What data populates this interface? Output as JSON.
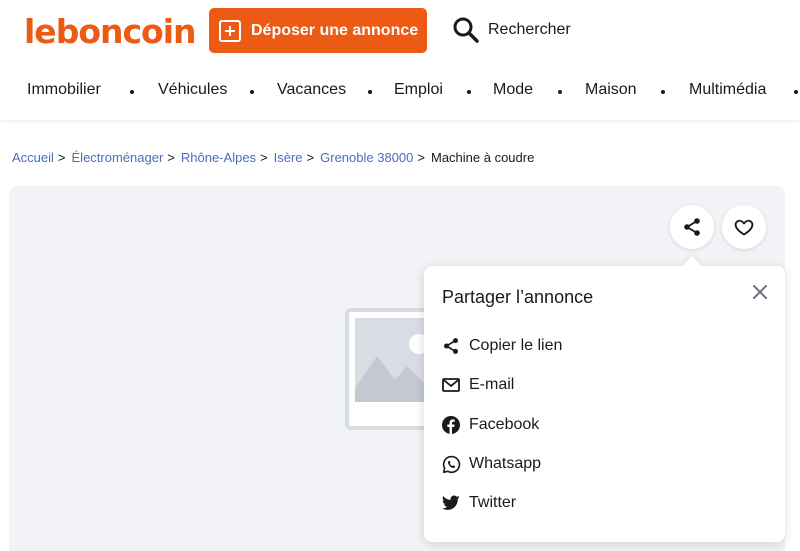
{
  "header": {
    "logo": "leboncoin",
    "post_button": "Déposer une annonce",
    "search_label": "Rechercher",
    "brand_color": "#ec5a13"
  },
  "nav": {
    "items": [
      "Immobilier",
      "Véhicules",
      "Vacances",
      "Emploi",
      "Mode",
      "Maison",
      "Multimédia"
    ]
  },
  "breadcrumb": {
    "links": [
      "Accueil",
      "Électroménager",
      "Rhône-Alpes",
      "Isère",
      "Grenoble 38000"
    ],
    "separator": ">",
    "current": "Machine à coudre"
  },
  "gallery": {
    "share_icon": "share-icon",
    "favorite_icon": "heart-icon",
    "placeholder_icon": "image-placeholder-icon"
  },
  "share_popover": {
    "title": "Partager l’annonce",
    "close_icon": "close-icon",
    "items": [
      {
        "label": "Copier le lien",
        "icon": "share-icon"
      },
      {
        "label": "E-mail",
        "icon": "mail-icon"
      },
      {
        "label": "Facebook",
        "icon": "facebook-icon"
      },
      {
        "label": "Whatsapp",
        "icon": "whatsapp-icon"
      },
      {
        "label": "Twitter",
        "icon": "twitter-icon"
      }
    ]
  }
}
